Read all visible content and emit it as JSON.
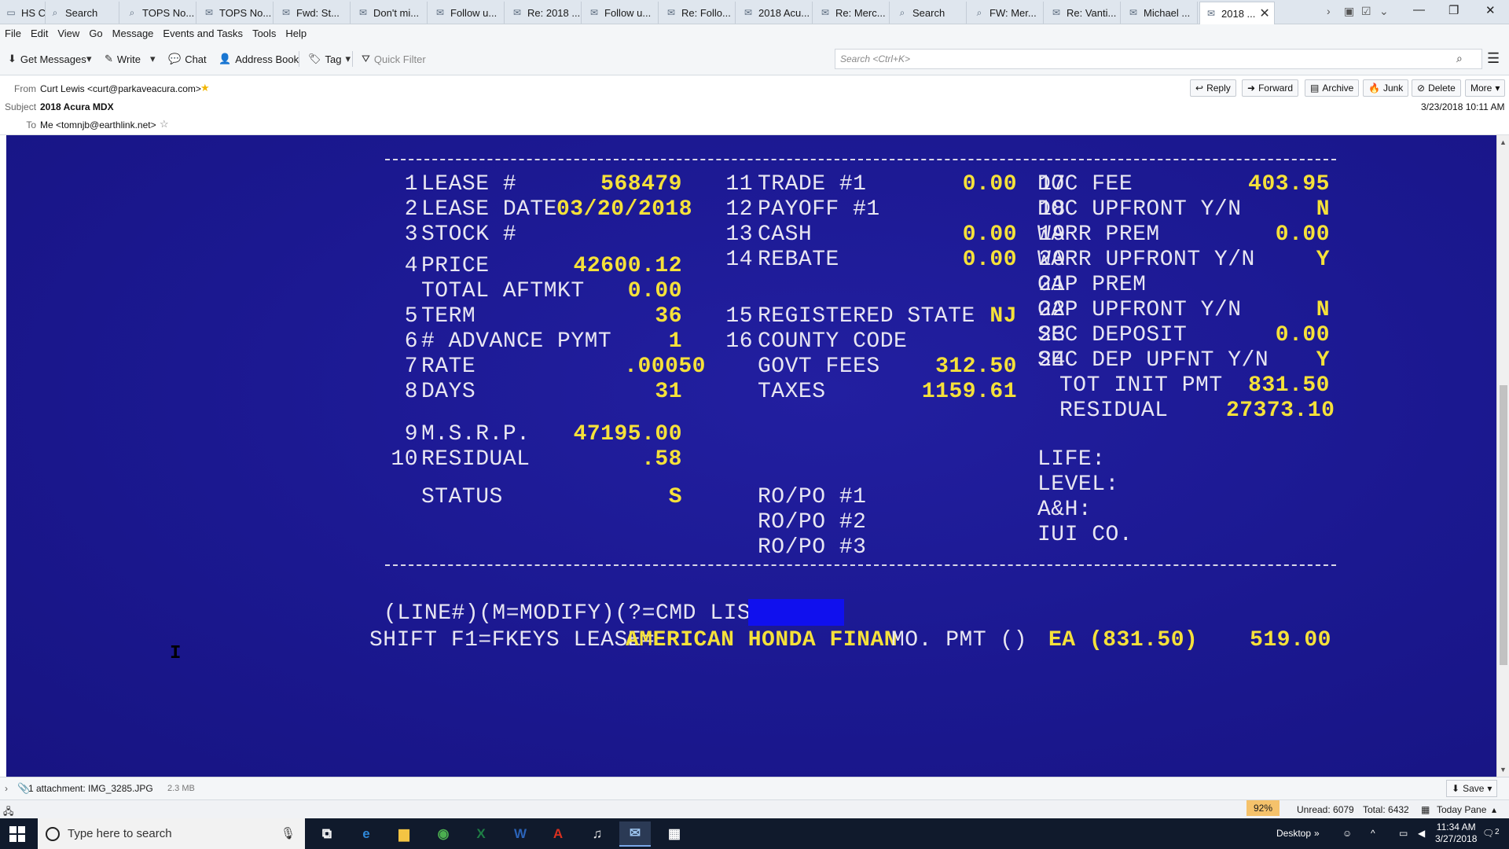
{
  "tabs": [
    {
      "label": "HS Cl...",
      "icon": "folder-icon"
    },
    {
      "label": "Search",
      "icon": "search-icon"
    },
    {
      "label": "TOPS No...",
      "icon": "search-icon"
    },
    {
      "label": "TOPS No...",
      "icon": "mail-icon"
    },
    {
      "label": "Fwd: St...",
      "icon": "mail-icon"
    },
    {
      "label": "Don't mi...",
      "icon": "mail-icon"
    },
    {
      "label": "Follow u...",
      "icon": "mail-icon"
    },
    {
      "label": "Re: 2018 ...",
      "icon": "mail-icon"
    },
    {
      "label": "Follow u...",
      "icon": "mail-icon"
    },
    {
      "label": "Re: Follo...",
      "icon": "mail-icon"
    },
    {
      "label": "2018 Acu...",
      "icon": "mail-icon"
    },
    {
      "label": "Re: Merc...",
      "icon": "mail-icon"
    },
    {
      "label": "Search",
      "icon": "search-icon"
    },
    {
      "label": "FW: Mer...",
      "icon": "search-icon"
    },
    {
      "label": "Re: Vanti...",
      "icon": "mail-icon"
    },
    {
      "label": "Michael ...",
      "icon": "mail-icon"
    },
    {
      "label": "2018 ...",
      "icon": "mail-icon",
      "active": true
    }
  ],
  "menubar": [
    "File",
    "Edit",
    "View",
    "Go",
    "Message",
    "Events and Tasks",
    "Tools",
    "Help"
  ],
  "toolbar": {
    "get_messages": "Get Messages",
    "write": "Write",
    "chat": "Chat",
    "address_book": "Address Book",
    "tag": "Tag",
    "quick_filter": "Quick Filter",
    "search_placeholder": "Search <Ctrl+K>"
  },
  "header": {
    "from_label": "From",
    "from_value": "Curt Lewis <curt@parkaveacura.com>",
    "subject_label": "Subject",
    "subject_value": "2018 Acura MDX",
    "to_label": "To",
    "to_value": "Me <tomnjb@earthlink.net>",
    "date": "3/23/2018 10:11 AM",
    "buttons": {
      "reply": "Reply",
      "forward": "Forward",
      "archive": "Archive",
      "junk": "Junk",
      "delete": "Delete",
      "more": "More"
    }
  },
  "terminal": {
    "col1": [
      {
        "num": "1",
        "label": "LEASE #",
        "value": "568479"
      },
      {
        "num": "2",
        "label": "LEASE DATE",
        "value": "03/20/2018"
      },
      {
        "num": "3",
        "label": "STOCK #",
        "value": ""
      },
      {
        "num": "4",
        "label": "PRICE",
        "value": "42600.12"
      },
      {
        "num": "",
        "label": "TOTAL AFTMKT",
        "value": "0.00"
      },
      {
        "num": "5",
        "label": "TERM",
        "value": "36"
      },
      {
        "num": "6",
        "label": "# ADVANCE PYMT",
        "value": "1"
      },
      {
        "num": "7",
        "label": "RATE",
        "value": ".00050"
      },
      {
        "num": "8",
        "label": "DAYS",
        "value": "31"
      },
      {
        "num": "9",
        "label": "M.S.R.P.",
        "value": "47195.00"
      },
      {
        "num": "10",
        "label": "RESIDUAL",
        "value": ".58"
      },
      {
        "num": "",
        "label": "STATUS",
        "value": "S"
      }
    ],
    "col2": [
      {
        "num": "11",
        "label": "TRADE #1",
        "value": "0.00"
      },
      {
        "num": "12",
        "label": "PAYOFF #1",
        "value": ""
      },
      {
        "num": "13",
        "label": "CASH",
        "value": "0.00"
      },
      {
        "num": "14",
        "label": "REBATE",
        "value": "0.00"
      },
      {
        "num": "15",
        "label": "REGISTERED STATE",
        "value": "NJ"
      },
      {
        "num": "16",
        "label": "COUNTY CODE",
        "value": ""
      },
      {
        "num": "",
        "label": "GOVT FEES",
        "value": "312.50"
      },
      {
        "num": "",
        "label": "TAXES",
        "value": "1159.61"
      },
      {
        "num": "",
        "label": "RO/PO #1",
        "value": ""
      },
      {
        "num": "",
        "label": "RO/PO #2",
        "value": ""
      },
      {
        "num": "",
        "label": "RO/PO #3",
        "value": ""
      }
    ],
    "col3": [
      {
        "num": "17",
        "label": "DOC FEE",
        "value": "403.95"
      },
      {
        "num": "18",
        "label": "DOC UPFRONT Y/N",
        "value": "N"
      },
      {
        "num": "19",
        "label": "WARR PREM",
        "value": "0.00"
      },
      {
        "num": "20",
        "label": "WARR UPFRONT Y/N",
        "value": "Y"
      },
      {
        "num": "21",
        "label": "GAP PREM",
        "value": ""
      },
      {
        "num": "22",
        "label": "GAP UPFRONT Y/N",
        "value": "N"
      },
      {
        "num": "23",
        "label": "SEC DEPOSIT",
        "value": "0.00"
      },
      {
        "num": "24",
        "label": "SEC DEP UPFNT Y/N",
        "value": "Y"
      },
      {
        "num": "",
        "label": "TOT INIT PMT",
        "value": "831.50"
      },
      {
        "num": "",
        "label": "RESIDUAL",
        "value": "27373.10"
      },
      {
        "num": "",
        "label": "LIFE:",
        "value": ""
      },
      {
        "num": "",
        "label": "LEVEL:",
        "value": ""
      },
      {
        "num": "",
        "label": "A&H:",
        "value": ""
      },
      {
        "num": "",
        "label": "IUI CO.",
        "value": ""
      }
    ],
    "prompt": "(LINE#)(M=MODIFY)(?=CMD LIST)",
    "footer": {
      "keys": "SHIFT F1=FKEYS LEASE=",
      "lessor": "AMERICAN HONDA FINAN",
      "mo_pmt": "MO. PMT ()",
      "ea": "EA (831.50)",
      "amount": "519.00"
    }
  },
  "attachment": {
    "label": "1 attachment: IMG_3285.JPG",
    "size": "2.3 MB",
    "save": "Save"
  },
  "statusbar": {
    "zoom": "92%",
    "unread": "Unread: 6079",
    "total": "Total: 6432",
    "today_pane": "Today Pane"
  },
  "taskbar": {
    "search_placeholder": "Type here to search",
    "desktop": "Desktop",
    "time": "11:34 AM",
    "date": "3/27/2018",
    "notifications": "2"
  }
}
